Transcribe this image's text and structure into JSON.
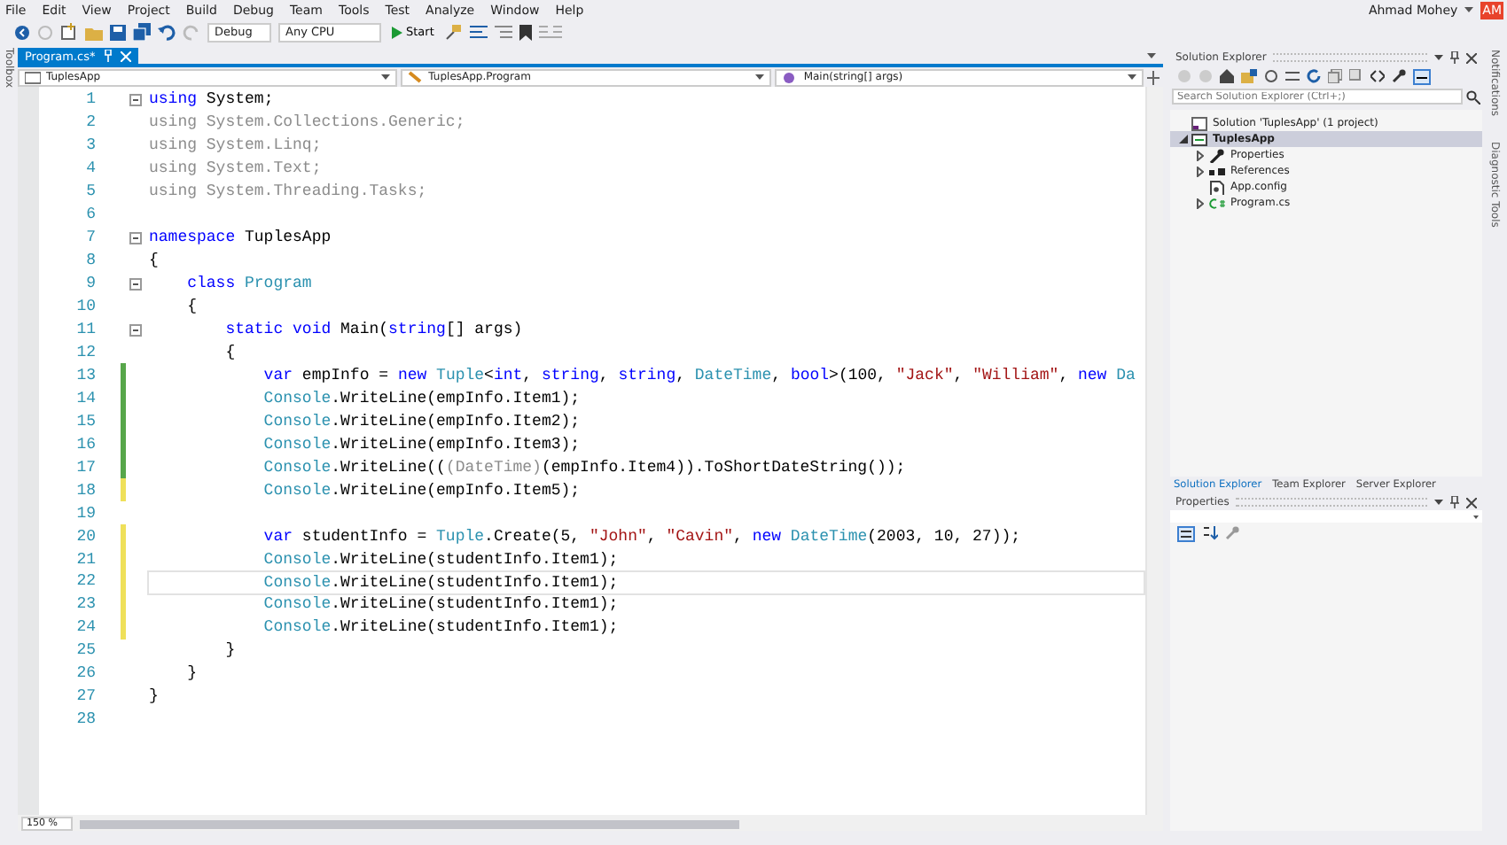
{
  "menu": [
    "File",
    "Edit",
    "View",
    "Project",
    "Build",
    "Debug",
    "Team",
    "Tools",
    "Test",
    "Analyze",
    "Window",
    "Help"
  ],
  "account": {
    "name": "Ahmad Mohey",
    "initials": "AM"
  },
  "toolbar": {
    "configuration": "Debug",
    "platform": "Any CPU",
    "start": "Start"
  },
  "toolbox_label": "Toolbox",
  "editor": {
    "tabs": [
      {
        "label": "Program.cs*",
        "selected": true
      }
    ],
    "nav": [
      "TuplesApp",
      "TuplesApp.Program",
      "Main(string[] args)"
    ],
    "lines": [
      {
        "number": "1",
        "fold": true,
        "current": false,
        "tokens": [
          {
            "kind": "kw",
            "text": "using"
          },
          {
            "kind": "plain",
            "text": " System;"
          }
        ]
      },
      {
        "number": "2",
        "fold": false,
        "current": false,
        "tokens": [
          {
            "kind": "gray",
            "text": "using System.Collections.Generic;"
          }
        ]
      },
      {
        "number": "3",
        "fold": false,
        "current": false,
        "tokens": [
          {
            "kind": "gray",
            "text": "using System.Linq;"
          }
        ]
      },
      {
        "number": "4",
        "fold": false,
        "current": false,
        "tokens": [
          {
            "kind": "gray",
            "text": "using System.Text;"
          }
        ]
      },
      {
        "number": "5",
        "fold": false,
        "current": false,
        "tokens": [
          {
            "kind": "gray",
            "text": "using System.Threading.Tasks;"
          }
        ]
      },
      {
        "number": "6",
        "fold": false,
        "current": false
      },
      {
        "number": "7",
        "fold": true,
        "current": false,
        "tokens": [
          {
            "kind": "kw",
            "text": "namespace"
          },
          {
            "kind": "plain",
            "text": " TuplesApp"
          }
        ]
      },
      {
        "number": "8",
        "fold": false,
        "current": false,
        "tokens": [
          {
            "kind": "plain",
            "text": "{"
          }
        ]
      },
      {
        "number": "9",
        "fold": true,
        "current": false,
        "tokens": [
          {
            "kind": "kw",
            "text": "    class"
          },
          {
            "kind": "type",
            "text": " Program"
          }
        ]
      },
      {
        "number": "10",
        "fold": false,
        "current": false,
        "tokens": [
          {
            "kind": "plain",
            "text": "    {"
          }
        ]
      },
      {
        "number": "11",
        "fold": true,
        "current": false,
        "tokens": [
          {
            "kind": "kw",
            "text": "        static void"
          },
          {
            "kind": "plain",
            "text": " Main("
          },
          {
            "kind": "kw",
            "text": "string"
          },
          {
            "kind": "plain",
            "text": "[] args)"
          }
        ]
      },
      {
        "number": "12",
        "fold": false,
        "current": false,
        "tokens": [
          {
            "kind": "plain",
            "text": "        {"
          }
        ]
      },
      {
        "number": "13",
        "fold": false,
        "color": "#57a64a",
        "current": false,
        "tokens": [
          {
            "kind": "kw",
            "text": "            var"
          },
          {
            "kind": "plain",
            "text": " empInfo = "
          },
          {
            "kind": "kw",
            "text": "new"
          },
          {
            "kind": "type",
            "text": " Tuple"
          },
          {
            "kind": "plain",
            "text": "<"
          },
          {
            "kind": "kw",
            "text": "int"
          },
          {
            "kind": "plain",
            "text": ", "
          },
          {
            "kind": "kw",
            "text": "string"
          },
          {
            "kind": "plain",
            "text": ", "
          },
          {
            "kind": "kw",
            "text": "string"
          },
          {
            "kind": "plain",
            "text": ", "
          },
          {
            "kind": "type",
            "text": "DateTime"
          },
          {
            "kind": "plain",
            "text": ", "
          },
          {
            "kind": "kw",
            "text": "bool"
          },
          {
            "kind": "plain",
            "text": ">(100, "
          },
          {
            "kind": "str",
            "text": "\"Jack\""
          },
          {
            "kind": "plain",
            "text": ", "
          },
          {
            "kind": "str",
            "text": "\"William\""
          },
          {
            "kind": "plain",
            "text": ", "
          },
          {
            "kind": "kw",
            "text": "new"
          },
          {
            "kind": "type",
            "text": " Da"
          }
        ]
      },
      {
        "number": "14",
        "fold": false,
        "color": "#57a64a",
        "current": false,
        "tokens": [
          {
            "kind": "type",
            "text": "            Console"
          },
          {
            "kind": "plain",
            "text": ".WriteLine(empInfo.Item1);"
          }
        ]
      },
      {
        "number": "15",
        "fold": false,
        "color": "#57a64a",
        "current": false,
        "tokens": [
          {
            "kind": "type",
            "text": "            Console"
          },
          {
            "kind": "plain",
            "text": ".WriteLine(empInfo.Item2);"
          }
        ]
      },
      {
        "number": "16",
        "fold": false,
        "color": "#57a64a",
        "current": false,
        "tokens": [
          {
            "kind": "type",
            "text": "            Console"
          },
          {
            "kind": "plain",
            "text": ".WriteLine(empInfo.Item3);"
          }
        ]
      },
      {
        "number": "17",
        "fold": false,
        "color": "#57a64a",
        "current": false,
        "tokens": [
          {
            "kind": "type",
            "text": "            Console"
          },
          {
            "kind": "plain",
            "text": ".WriteLine(("
          },
          {
            "kind": "gray",
            "text": "(DateTime)"
          },
          {
            "kind": "plain",
            "text": "(empInfo.Item4)).ToShortDateString());"
          }
        ]
      },
      {
        "number": "18",
        "fold": false,
        "color": "#efe05a",
        "current": false,
        "tokens": [
          {
            "kind": "type",
            "text": "            Console"
          },
          {
            "kind": "plain",
            "text": ".WriteLine(empInfo.Item5);"
          }
        ]
      },
      {
        "number": "19",
        "fold": false,
        "current": false
      },
      {
        "number": "20",
        "fold": false,
        "color": "#efe05a",
        "current": false,
        "tokens": [
          {
            "kind": "kw",
            "text": "            var"
          },
          {
            "kind": "plain",
            "text": " studentInfo = "
          },
          {
            "kind": "type",
            "text": "Tuple"
          },
          {
            "kind": "plain",
            "text": ".Create(5, "
          },
          {
            "kind": "str",
            "text": "\"John\""
          },
          {
            "kind": "plain",
            "text": ", "
          },
          {
            "kind": "str",
            "text": "\"Cavin\""
          },
          {
            "kind": "plain",
            "text": ", "
          },
          {
            "kind": "kw",
            "text": "new"
          },
          {
            "kind": "type",
            "text": " DateTime"
          },
          {
            "kind": "plain",
            "text": "(2003, 10, 27));"
          }
        ]
      },
      {
        "number": "21",
        "fold": false,
        "color": "#efe05a",
        "current": false,
        "tokens": [
          {
            "kind": "type",
            "text": "            Console"
          },
          {
            "kind": "plain",
            "text": ".WriteLine(studentInfo.Item1);"
          }
        ]
      },
      {
        "number": "22",
        "fold": false,
        "color": "#efe05a",
        "current": true,
        "tokens": [
          {
            "kind": "type",
            "text": "            Console"
          },
          {
            "kind": "plain",
            "text": ".WriteLine(studentInfo.Item1);"
          }
        ]
      },
      {
        "number": "23",
        "fold": false,
        "color": "#efe05a",
        "current": false,
        "tokens": [
          {
            "kind": "type",
            "text": "            Console"
          },
          {
            "kind": "plain",
            "text": ".WriteLine(studentInfo.Item1);"
          }
        ]
      },
      {
        "number": "24",
        "fold": false,
        "color": "#efe05a",
        "current": false,
        "tokens": [
          {
            "kind": "type",
            "text": "            Console"
          },
          {
            "kind": "plain",
            "text": ".WriteLine(studentInfo.Item1);"
          }
        ]
      },
      {
        "number": "25",
        "fold": false,
        "current": false,
        "tokens": [
          {
            "kind": "plain",
            "text": "        }"
          }
        ]
      },
      {
        "number": "26",
        "fold": false,
        "current": false,
        "tokens": [
          {
            "kind": "plain",
            "text": "    }"
          }
        ]
      },
      {
        "number": "27",
        "fold": false,
        "current": false,
        "tokens": [
          {
            "kind": "plain",
            "text": "}"
          }
        ]
      },
      {
        "number": "28",
        "fold": false,
        "current": false
      }
    ],
    "zoom": "150 %"
  },
  "solution_explorer": {
    "title": "Solution Explorer",
    "search_placeholder": "Search Solution Explorer (Ctrl+;)",
    "tree": [
      {
        "label": "Solution 'TuplesApp' (1 project)",
        "kind": "solution",
        "selected": false,
        "children": [
          {
            "label": "TuplesApp",
            "kind": "project",
            "selected": true,
            "expanded": true,
            "children": [
              {
                "label": "Properties",
                "kind": "properties",
                "selected": false,
                "expanded": false
              },
              {
                "label": "References",
                "kind": "references",
                "selected": false,
                "expanded": false
              },
              {
                "label": "App.config",
                "kind": "config",
                "selected": false
              },
              {
                "label": "Program.cs",
                "kind": "csharp",
                "selected": false,
                "expanded": false
              }
            ]
          }
        ]
      }
    ],
    "tabs": [
      {
        "label": "Solution Explorer",
        "selected": true
      },
      {
        "label": "Team Explorer",
        "selected": false
      },
      {
        "label": "Server Explorer",
        "selected": false
      }
    ]
  },
  "properties": {
    "title": "Properties"
  },
  "side_tabs": [
    "Notifications",
    "Diagnostic Tools"
  ]
}
